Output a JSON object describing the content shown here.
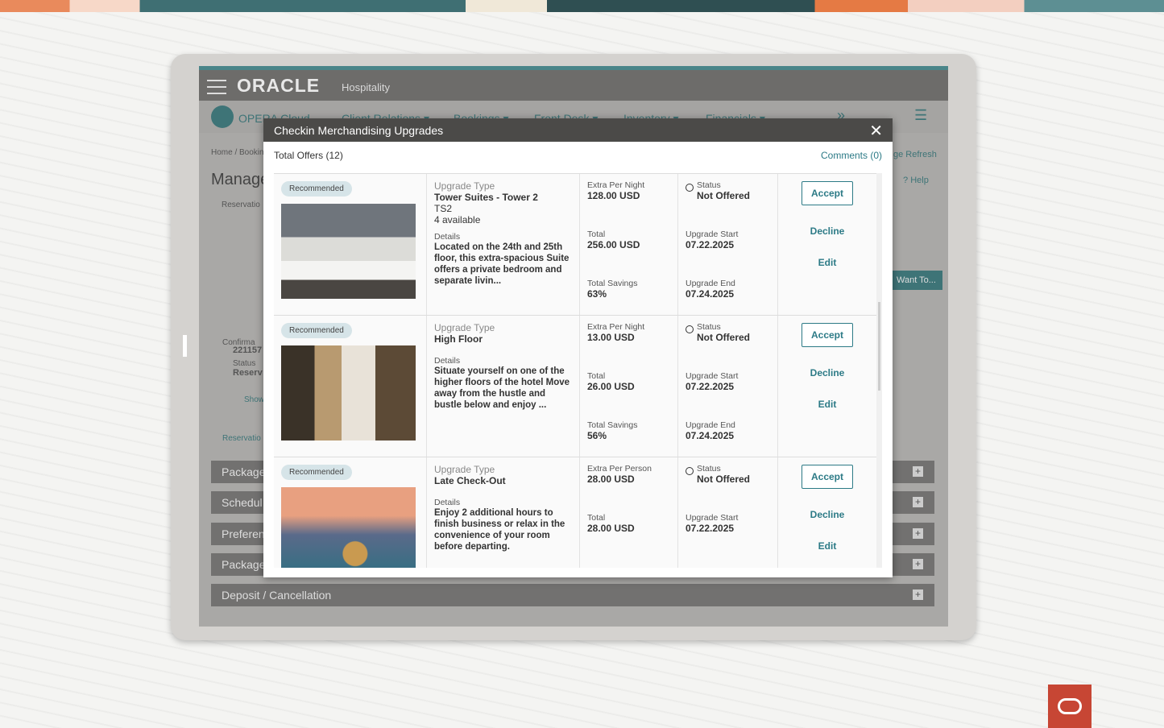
{
  "app": {
    "logo": "ORACLE",
    "subtitle": "Hospitality",
    "product": "OPERA Cloud",
    "nav": [
      "Client Relations ▾",
      "Bookings ▾",
      "Front Desk ▾",
      "Inventory ▾",
      "Financials ▾"
    ],
    "breadcrumb": "Home / Bookin",
    "page_title": "Manage",
    "tab": "Reservatio",
    "info": "C",
    "confirmation_label": "Confirma",
    "confirmation": "221157",
    "status_label": "Status",
    "status": "Reserv",
    "show": "Show",
    "reservation_link": "Reservatio",
    "page_refresh": "ge Refresh",
    "help": "Help",
    "want_to": "Want To...",
    "sections": [
      "Package",
      "Schedul",
      "Preferen",
      "Package",
      "Deposit / Cancellation"
    ]
  },
  "modal": {
    "title": "Checkin Merchandising Upgrades",
    "total_offers": "Total Offers (12)",
    "comments": "Comments (0)",
    "offers": [
      {
        "badge": "Recommended",
        "type_label": "Upgrade Type",
        "type": "Tower Suites - Tower 2",
        "code": "TS2",
        "available": "4 available",
        "details_label": "Details",
        "details": "Located on the 24th and 25th floor, this extra-spacious Suite offers a private bedroom and separate livin...",
        "price_label": "Extra Per Night",
        "price": "128.00 USD",
        "total_label": "Total",
        "total": "256.00 USD",
        "savings_label": "Total Savings",
        "savings": "63%",
        "status_label": "Status",
        "status": "Not Offered",
        "start_label": "Upgrade Start",
        "start": "07.22.2025",
        "end_label": "Upgrade End",
        "end": "07.24.2025",
        "accept": "Accept",
        "decline": "Decline",
        "edit": "Edit"
      },
      {
        "badge": "Recommended",
        "type_label": "Upgrade Type",
        "type": "High Floor",
        "details_label": "Details",
        "details": "Situate yourself on one of the higher floors of the hotel Move away from the hustle and bustle below and enjoy ...",
        "price_label": "Extra Per Night",
        "price": "13.00 USD",
        "total_label": "Total",
        "total": "26.00 USD",
        "savings_label": "Total Savings",
        "savings": "56%",
        "status_label": "Status",
        "status": "Not Offered",
        "start_label": "Upgrade Start",
        "start": "07.22.2025",
        "end_label": "Upgrade End",
        "end": "07.24.2025",
        "accept": "Accept",
        "decline": "Decline",
        "edit": "Edit"
      },
      {
        "badge": "Recommended",
        "type_label": "Upgrade Type",
        "type": "Late Check-Out",
        "details_label": "Details",
        "details": "Enjoy 2 additional hours to finish business or relax in the convenience of your room before departing.",
        "price_label": "Extra Per Person",
        "price": "28.00 USD",
        "total_label": "Total",
        "total": "28.00 USD",
        "status_label": "Status",
        "status": "Not Offered",
        "start_label": "Upgrade Start",
        "start": "07.22.2025",
        "accept": "Accept",
        "decline": "Decline",
        "edit": "Edit"
      }
    ]
  },
  "colors": {
    "accent": "#2c7a86",
    "brand_red": "#c74634"
  }
}
